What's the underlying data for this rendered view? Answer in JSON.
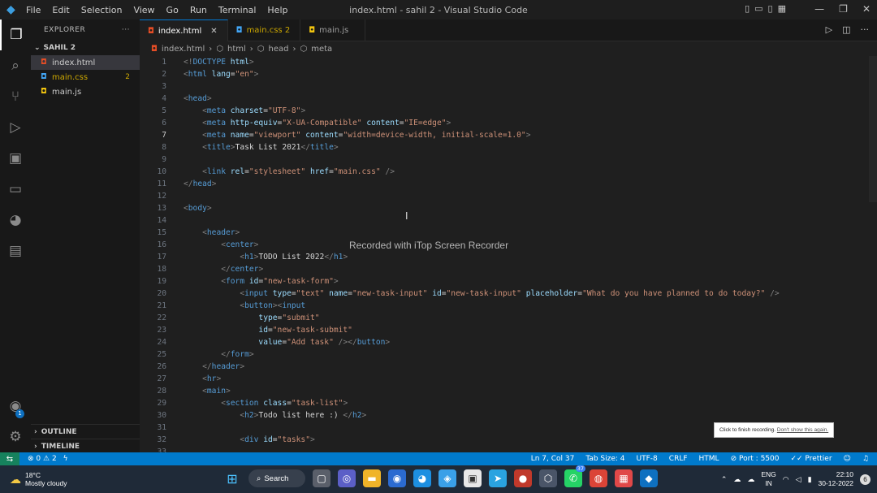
{
  "titlebar": {
    "menu": [
      "File",
      "Edit",
      "Selection",
      "View",
      "Go",
      "Run",
      "Terminal",
      "Help"
    ],
    "title": "index.html - sahil 2 - Visual Studio Code"
  },
  "sidebar": {
    "header": "EXPLORER",
    "folder": "SAHIL 2",
    "files": [
      {
        "name": "index.html",
        "icon_color": "#e44d26",
        "text_color": "#cccccc"
      },
      {
        "name": "main.css",
        "icon_color": "#42a5f5",
        "text_color": "#cca700",
        "count": "2"
      },
      {
        "name": "main.js",
        "icon_color": "#f1c40f",
        "text_color": "#cccccc"
      }
    ],
    "outline": "OUTLINE",
    "timeline": "TIMELINE"
  },
  "tabs": [
    {
      "label": "index.html",
      "active": true
    },
    {
      "label": "main.css 2",
      "active": false
    },
    {
      "label": "main.js",
      "active": false
    }
  ],
  "breadcrumb": [
    "index.html",
    "html",
    "head",
    "meta"
  ],
  "code": [
    {
      "n": "1",
      "t": [
        [
          "tg",
          "<!"
        ],
        [
          "tn",
          "DOCTYPE"
        ],
        [
          "tx",
          " "
        ],
        [
          "at",
          "html"
        ],
        [
          "tg",
          ">"
        ]
      ]
    },
    {
      "n": "2",
      "t": [
        [
          "tg",
          "<"
        ],
        [
          "tn",
          "html"
        ],
        [
          "tx",
          " "
        ],
        [
          "at",
          "lang"
        ],
        [
          "tx",
          "="
        ],
        [
          "st",
          "\"en\""
        ],
        [
          "tg",
          ">"
        ]
      ]
    },
    {
      "n": "3",
      "t": []
    },
    {
      "n": "4",
      "t": [
        [
          "tg",
          "<"
        ],
        [
          "tn",
          "head"
        ],
        [
          "tg",
          ">"
        ]
      ]
    },
    {
      "n": "5",
      "t": [
        [
          "tx",
          "    "
        ],
        [
          "tg",
          "<"
        ],
        [
          "tn",
          "meta"
        ],
        [
          "tx",
          " "
        ],
        [
          "at",
          "charset"
        ],
        [
          "tx",
          "="
        ],
        [
          "st",
          "\"UTF-8\""
        ],
        [
          "tg",
          ">"
        ]
      ]
    },
    {
      "n": "6",
      "t": [
        [
          "tx",
          "    "
        ],
        [
          "tg",
          "<"
        ],
        [
          "tn",
          "meta"
        ],
        [
          "tx",
          " "
        ],
        [
          "at",
          "http-equiv"
        ],
        [
          "tx",
          "="
        ],
        [
          "st",
          "\"X-UA-Compatible\""
        ],
        [
          "tx",
          " "
        ],
        [
          "at",
          "content"
        ],
        [
          "tx",
          "="
        ],
        [
          "st",
          "\"IE=edge\""
        ],
        [
          "tg",
          ">"
        ]
      ]
    },
    {
      "n": "7",
      "t": [
        [
          "tx",
          "    "
        ],
        [
          "tg",
          "<"
        ],
        [
          "tn",
          "meta"
        ],
        [
          "tx",
          " "
        ],
        [
          "at",
          "name"
        ],
        [
          "tx",
          "="
        ],
        [
          "st",
          "\"viewport\""
        ],
        [
          "tx",
          " "
        ],
        [
          "at",
          "content"
        ],
        [
          "tx",
          "="
        ],
        [
          "st",
          "\"width=device-width, initial-scale=1.0\""
        ],
        [
          "tg",
          ">"
        ]
      ]
    },
    {
      "n": "8",
      "t": [
        [
          "tx",
          "    "
        ],
        [
          "tg",
          "<"
        ],
        [
          "tn",
          "title"
        ],
        [
          "tg",
          ">"
        ],
        [
          "tx",
          "Task List 2021"
        ],
        [
          "tg",
          "</"
        ],
        [
          "tn",
          "title"
        ],
        [
          "tg",
          ">"
        ]
      ]
    },
    {
      "n": "9",
      "t": []
    },
    {
      "n": "10",
      "t": [
        [
          "tx",
          "    "
        ],
        [
          "tg",
          "<"
        ],
        [
          "tn",
          "link"
        ],
        [
          "tx",
          " "
        ],
        [
          "at",
          "rel"
        ],
        [
          "tx",
          "="
        ],
        [
          "st",
          "\"stylesheet\""
        ],
        [
          "tx",
          " "
        ],
        [
          "at",
          "href"
        ],
        [
          "tx",
          "="
        ],
        [
          "st",
          "\"main.css\""
        ],
        [
          "tx",
          " "
        ],
        [
          "tg",
          "/>"
        ]
      ]
    },
    {
      "n": "11",
      "t": [
        [
          "tg",
          "</"
        ],
        [
          "tn",
          "head"
        ],
        [
          "tg",
          ">"
        ]
      ]
    },
    {
      "n": "12",
      "t": []
    },
    {
      "n": "13",
      "t": [
        [
          "tg",
          "<"
        ],
        [
          "tn",
          "body"
        ],
        [
          "tg",
          ">"
        ]
      ]
    },
    {
      "n": "14",
      "t": []
    },
    {
      "n": "15",
      "t": [
        [
          "tx",
          "    "
        ],
        [
          "tg",
          "<"
        ],
        [
          "tn",
          "header"
        ],
        [
          "tg",
          ">"
        ]
      ]
    },
    {
      "n": "16",
      "t": [
        [
          "tx",
          "        "
        ],
        [
          "tg",
          "<"
        ],
        [
          "tn",
          "center"
        ],
        [
          "tg",
          ">"
        ]
      ]
    },
    {
      "n": "17",
      "t": [
        [
          "tx",
          "            "
        ],
        [
          "tg",
          "<"
        ],
        [
          "tn",
          "h1"
        ],
        [
          "tg",
          ">"
        ],
        [
          "tx",
          "TODO List 2022"
        ],
        [
          "tg",
          "</"
        ],
        [
          "tn",
          "h1"
        ],
        [
          "tg",
          ">"
        ]
      ]
    },
    {
      "n": "18",
      "t": [
        [
          "tx",
          "        "
        ],
        [
          "tg",
          "</"
        ],
        [
          "tn",
          "center"
        ],
        [
          "tg",
          ">"
        ]
      ]
    },
    {
      "n": "19",
      "t": [
        [
          "tx",
          "        "
        ],
        [
          "tg",
          "<"
        ],
        [
          "tn",
          "form"
        ],
        [
          "tx",
          " "
        ],
        [
          "at",
          "id"
        ],
        [
          "tx",
          "="
        ],
        [
          "st",
          "\"new-task-form\""
        ],
        [
          "tg",
          ">"
        ]
      ]
    },
    {
      "n": "20",
      "t": [
        [
          "tx",
          "            "
        ],
        [
          "tg",
          "<"
        ],
        [
          "tn",
          "input"
        ],
        [
          "tx",
          " "
        ],
        [
          "at",
          "type"
        ],
        [
          "tx",
          "="
        ],
        [
          "st",
          "\"text\""
        ],
        [
          "tx",
          " "
        ],
        [
          "at",
          "name"
        ],
        [
          "tx",
          "="
        ],
        [
          "st",
          "\"new-task-input\""
        ],
        [
          "tx",
          " "
        ],
        [
          "at",
          "id"
        ],
        [
          "tx",
          "="
        ],
        [
          "st",
          "\"new-task-input\""
        ],
        [
          "tx",
          " "
        ],
        [
          "at",
          "placeholder"
        ],
        [
          "tx",
          "="
        ],
        [
          "st",
          "\"What do you have planned to do today?\""
        ],
        [
          "tx",
          " "
        ],
        [
          "tg",
          "/>"
        ]
      ]
    },
    {
      "n": "21",
      "t": [
        [
          "tx",
          "            "
        ],
        [
          "tg",
          "<"
        ],
        [
          "tn",
          "button"
        ],
        [
          "tg",
          "><"
        ],
        [
          "tn",
          "input"
        ]
      ]
    },
    {
      "n": "22",
      "t": [
        [
          "tx",
          "                "
        ],
        [
          "at",
          "type"
        ],
        [
          "tx",
          "="
        ],
        [
          "st",
          "\"submit\""
        ]
      ]
    },
    {
      "n": "23",
      "t": [
        [
          "tx",
          "                "
        ],
        [
          "at",
          "id"
        ],
        [
          "tx",
          "="
        ],
        [
          "st",
          "\"new-task-submit\""
        ]
      ]
    },
    {
      "n": "24",
      "t": [
        [
          "tx",
          "                "
        ],
        [
          "at",
          "value"
        ],
        [
          "tx",
          "="
        ],
        [
          "st",
          "\"Add task\""
        ],
        [
          "tx",
          " "
        ],
        [
          "tg",
          "/></"
        ],
        [
          "tn",
          "button"
        ],
        [
          "tg",
          ">"
        ]
      ]
    },
    {
      "n": "25",
      "t": [
        [
          "tx",
          "        "
        ],
        [
          "tg",
          "</"
        ],
        [
          "tn",
          "form"
        ],
        [
          "tg",
          ">"
        ]
      ]
    },
    {
      "n": "26",
      "t": [
        [
          "tx",
          "    "
        ],
        [
          "tg",
          "</"
        ],
        [
          "tn",
          "header"
        ],
        [
          "tg",
          ">"
        ]
      ]
    },
    {
      "n": "27",
      "t": [
        [
          "tx",
          "    "
        ],
        [
          "tg",
          "<"
        ],
        [
          "tn",
          "hr"
        ],
        [
          "tg",
          ">"
        ]
      ]
    },
    {
      "n": "28",
      "t": [
        [
          "tx",
          "    "
        ],
        [
          "tg",
          "<"
        ],
        [
          "tn",
          "main"
        ],
        [
          "tg",
          ">"
        ]
      ]
    },
    {
      "n": "29",
      "t": [
        [
          "tx",
          "        "
        ],
        [
          "tg",
          "<"
        ],
        [
          "tn",
          "section"
        ],
        [
          "tx",
          " "
        ],
        [
          "at",
          "class"
        ],
        [
          "tx",
          "="
        ],
        [
          "st",
          "\"task-list\""
        ],
        [
          "tg",
          ">"
        ]
      ]
    },
    {
      "n": "30",
      "t": [
        [
          "tx",
          "            "
        ],
        [
          "tg",
          "<"
        ],
        [
          "tn",
          "h2"
        ],
        [
          "tg",
          ">"
        ],
        [
          "tx",
          "Todo list here :)"
        ],
        [
          "tg",
          " </"
        ],
        [
          "tn",
          "h2"
        ],
        [
          "tg",
          ">"
        ]
      ]
    },
    {
      "n": "31",
      "t": []
    },
    {
      "n": "32",
      "t": [
        [
          "tx",
          "            "
        ],
        [
          "tg",
          "<"
        ],
        [
          "tn",
          "div"
        ],
        [
          "tx",
          " "
        ],
        [
          "at",
          "id"
        ],
        [
          "tx",
          "="
        ],
        [
          "st",
          "\"tasks\""
        ],
        [
          "tg",
          ">"
        ]
      ]
    },
    {
      "n": "33",
      "t": []
    }
  ],
  "current_line": "7",
  "watermark": "Recorded with iTop Screen Recorder",
  "tooltip": {
    "text": "Click to finish recording.",
    "link": "Don't show this again."
  },
  "statusbar": {
    "errors": "0",
    "warnings": "2",
    "position": "Ln 7, Col 37",
    "tab_size": "Tab Size: 4",
    "encoding": "UTF-8",
    "eol": "CRLF",
    "language": "HTML",
    "port": "Port : 5500",
    "prettier": "Prettier"
  },
  "taskbar": {
    "temperature": "18°C",
    "weather": "Mostly cloudy",
    "search": "Search",
    "whatsapp_badge": "37",
    "lang1": "ENG",
    "lang2": "IN",
    "time": "22:10",
    "date": "30-12-2022",
    "notif": "6"
  },
  "colors": {
    "accent": "#007acc",
    "remote": "#16825d",
    "editor_bg": "#1f1f1f"
  }
}
